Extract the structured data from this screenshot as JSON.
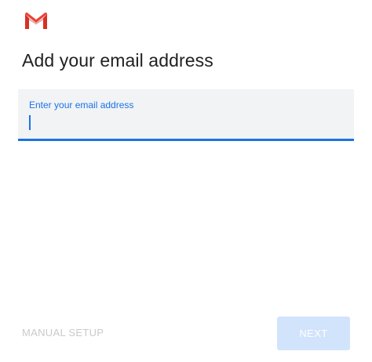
{
  "logo": {
    "icon": "gmail-m-icon",
    "colors": {
      "red": "#d93025",
      "light_red": "#ea4335",
      "shadow": "#b31412"
    }
  },
  "header": {
    "title": "Add your email address"
  },
  "email_field": {
    "label": "Enter your email address",
    "value": "",
    "state": "focused",
    "accent_color": "#1a73e8",
    "background": "#f1f3f4"
  },
  "actions": {
    "manual_setup_label": "MANUAL SETUP",
    "manual_setup_enabled": false,
    "next_label": "NEXT",
    "next_enabled": false,
    "next_background": "#d2e3fc"
  }
}
